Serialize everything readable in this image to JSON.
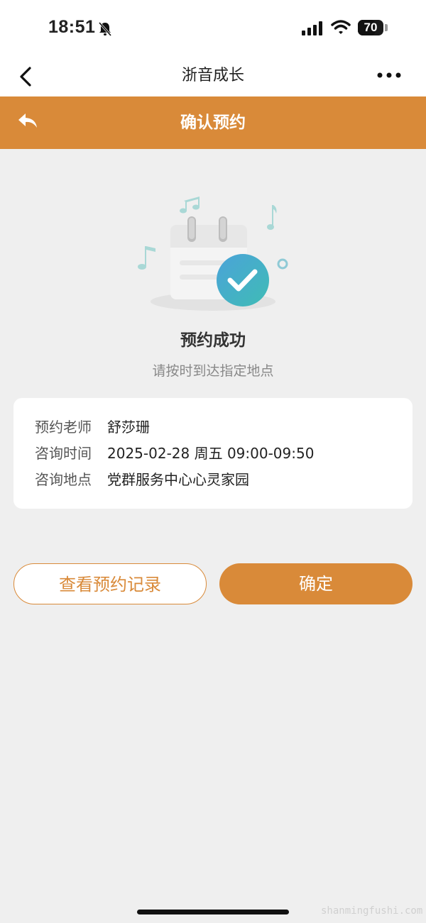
{
  "status_bar": {
    "time": "18:51",
    "battery": "70",
    "battery_level": 0.7
  },
  "nav": {
    "title": "浙音成长"
  },
  "header": {
    "title": "确认预约"
  },
  "result": {
    "title": "预约成功",
    "subtitle": "请按时到达指定地点"
  },
  "appointment": {
    "rows": [
      {
        "label": "预约老师",
        "value": "舒莎珊"
      },
      {
        "label": "咨询时间",
        "value": "2025-02-28 周五 09:00-09:50"
      },
      {
        "label": "咨询地点",
        "value": "党群服务中心心灵家园"
      }
    ]
  },
  "buttons": {
    "records": "查看预约记录",
    "confirm": "确定"
  },
  "watermark": "shanmingfushi.com",
  "colors": {
    "accent": "#d98a39",
    "check": "#3fa6c4",
    "background": "#efefef"
  }
}
